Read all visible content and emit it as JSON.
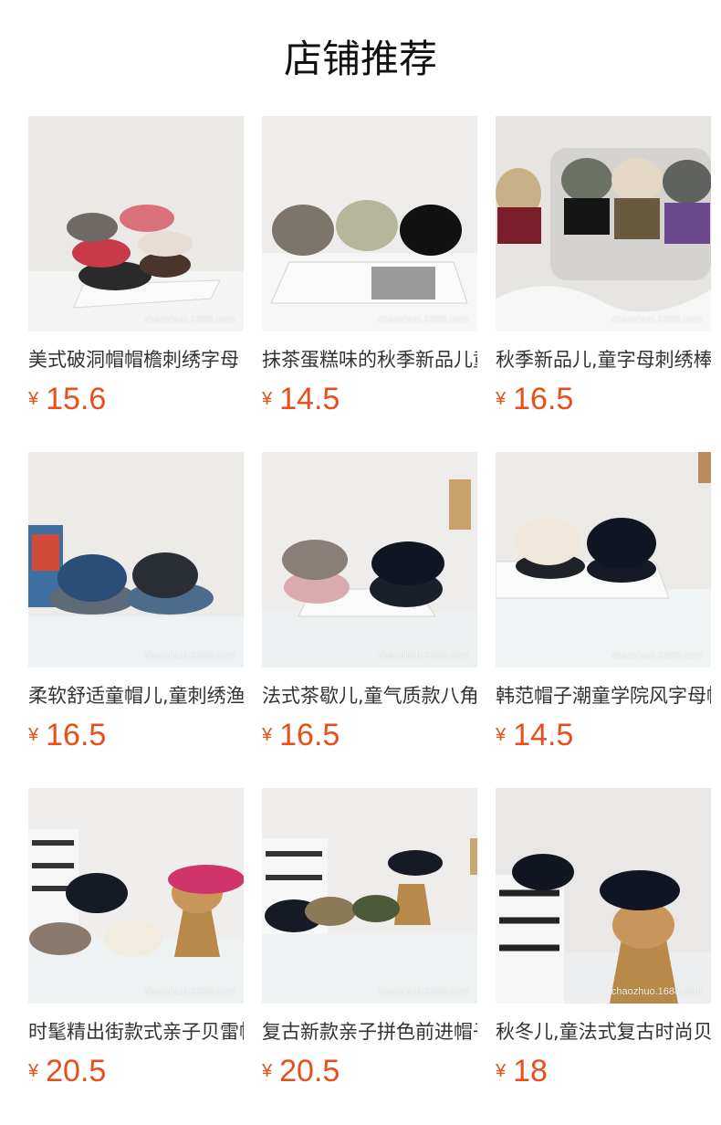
{
  "page": {
    "title": "店铺推荐"
  },
  "products": [
    {
      "name": "美式破洞帽帽檐刺绣字母",
      "currency": "¥",
      "price": "15.6",
      "watermark": "chaozhuo.1688.com",
      "icon": "caps-stack"
    },
    {
      "name": "抹茶蛋糕味的秋季新品儿童",
      "currency": "¥",
      "price": "14.5",
      "watermark": "chaozhuo.1688.com",
      "icon": "cap-letters"
    },
    {
      "name": "秋季新品儿,童字母刺绣棒球",
      "currency": "¥",
      "price": "16.5",
      "watermark": "chaozhuo.1688.com",
      "icon": "caps-basket"
    },
    {
      "name": "柔软舒适童帽儿,童刺绣渔夫",
      "currency": "¥",
      "price": "16.5",
      "watermark": "chaozhuo.1688.com",
      "icon": "bucket-hats"
    },
    {
      "name": "法式茶歇儿,童气质款八角帽",
      "currency": "¥",
      "price": "16.5",
      "watermark": "chaozhuo.1688.com",
      "icon": "newsboy-caps"
    },
    {
      "name": "韩范帽子潮童学院风字母帽",
      "currency": "¥",
      "price": "14.5",
      "watermark": "chaozhuo.1688.com",
      "icon": "top-caps"
    },
    {
      "name": "时髦精出街款式亲子贝雷帽",
      "currency": "¥",
      "price": "20.5",
      "watermark": "chaozhuo.1688.com",
      "icon": "berets-display"
    },
    {
      "name": "复古新款亲子拼色前进帽子",
      "currency": "¥",
      "price": "20.5",
      "watermark": "chaozhuo.1688.com",
      "icon": "ivy-caps"
    },
    {
      "name": "秋冬儿,童法式复古时尚贝雷",
      "currency": "¥",
      "price": "18",
      "watermark": "chaozhuo.1688.com",
      "icon": "berets-mannequin"
    }
  ]
}
